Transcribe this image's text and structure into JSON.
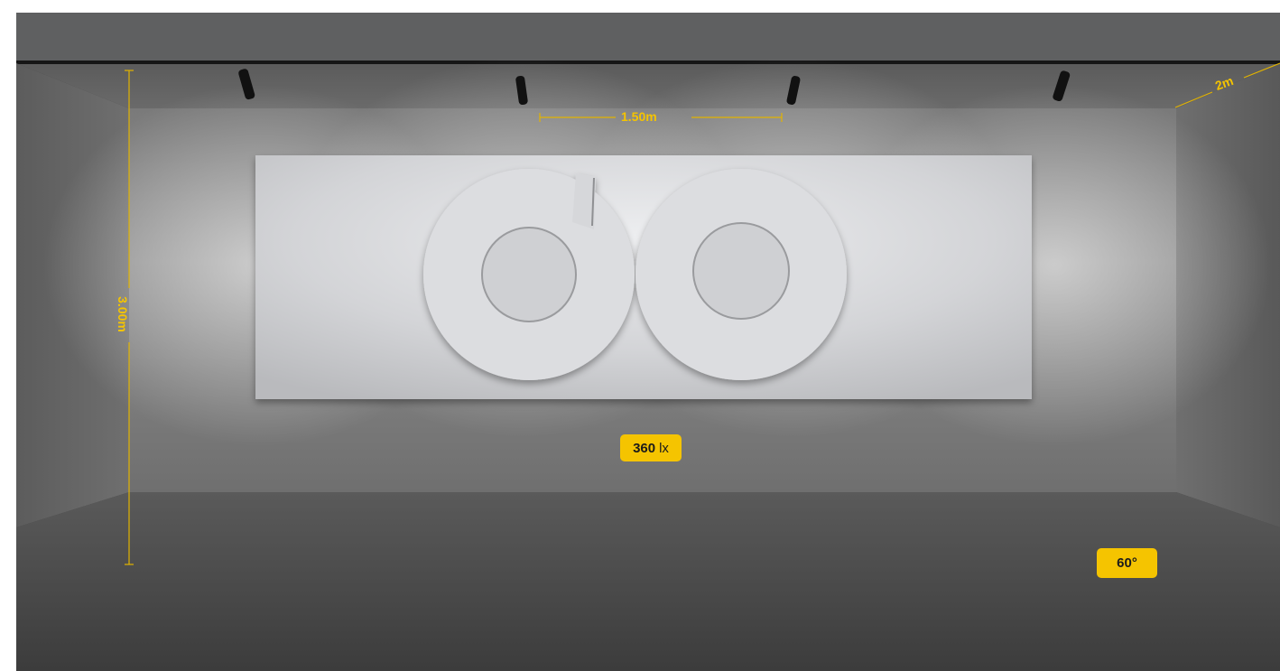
{
  "scene": {
    "dimensions": {
      "beam_spacing": "1.50m",
      "ceiling_height": "3.00m",
      "room_depth": "2m"
    },
    "illuminance": {
      "value": "360",
      "unit": "lx"
    },
    "beam_angle": "60°",
    "colors": {
      "accent": "#f5c400",
      "wall": "#8a8a8a",
      "panel": "#d8d9dc",
      "floor": "#4a4a4a",
      "spotlight": "#111111"
    }
  }
}
